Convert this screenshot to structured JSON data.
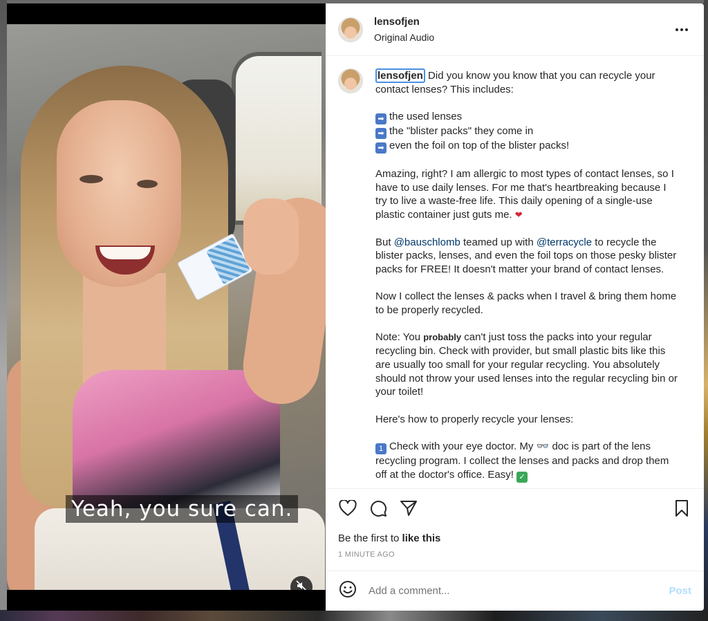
{
  "video": {
    "subtitle": "Yeah, you sure can."
  },
  "post": {
    "username": "lensofjen",
    "audio": "Original Audio"
  },
  "caption": {
    "username": "lensofjen",
    "intro": "Did you know you know that you can recycle your contact lenses? This includes:",
    "bullets": [
      "the used lenses",
      "the \"blister packs\" they come in",
      "even the foil on top of the blister packs!"
    ],
    "para_amazing": "Amazing, right? I am allergic to most types of contact lenses, so I have to use daily lenses. For me that's heartbreaking because I try to live a waste-free life. This daily opening of a single-use plastic container just guts me.",
    "para_but_start": "But ",
    "mention_1": "@bauschlomb",
    "para_but_mid": " teamed up with ",
    "mention_2": "@terracycle",
    "para_but_end": " to recycle the blister packs, lenses, and even the foil tops on those pesky blister packs for FREE! It doesn't matter your brand of contact lenses.",
    "para_now": "Now I collect the lenses & packs when I travel & bring them home to be properly recycled.",
    "para_note_start": "Note: You ",
    "para_note_bold": "probably",
    "para_note_end": " can't just toss the packs into your regular recycling bin. Check with provider, but small plastic bits like this are usually too small for your regular recycling. You absolutely should not throw your used lenses into the regular recycling bin or your toilet!",
    "para_how": "Here's how to properly recycle your lenses:",
    "step_1_start": "Check with your eye doctor. My ",
    "step_1_end": " doc is part of the lens recycling program. I collect the lenses and packs and drop them off at the doctor's office. Easy!",
    "step_number_glyph": "1",
    "arrow_glyph": "➡",
    "glasses_glyph": "👓",
    "check_glyph": "✓",
    "heart_glyph": "❤"
  },
  "actions": {
    "likes_prefix": "Be the first to ",
    "likes_link": "like this",
    "timestamp": "1 MINUTE AGO"
  },
  "comment": {
    "placeholder": "Add a comment...",
    "post_label": "Post"
  },
  "icons": {
    "more": "more-options-icon",
    "like": "heart-icon",
    "comment": "comment-icon",
    "share": "share-icon",
    "save": "bookmark-icon",
    "emoji": "emoji-icon",
    "mute": "muted-speaker-icon"
  },
  "colors": {
    "link": "#00376b",
    "post_disabled": "#b2dffc",
    "meta_gray": "#8e8e8e",
    "focus_outline": "#4a90e2"
  }
}
